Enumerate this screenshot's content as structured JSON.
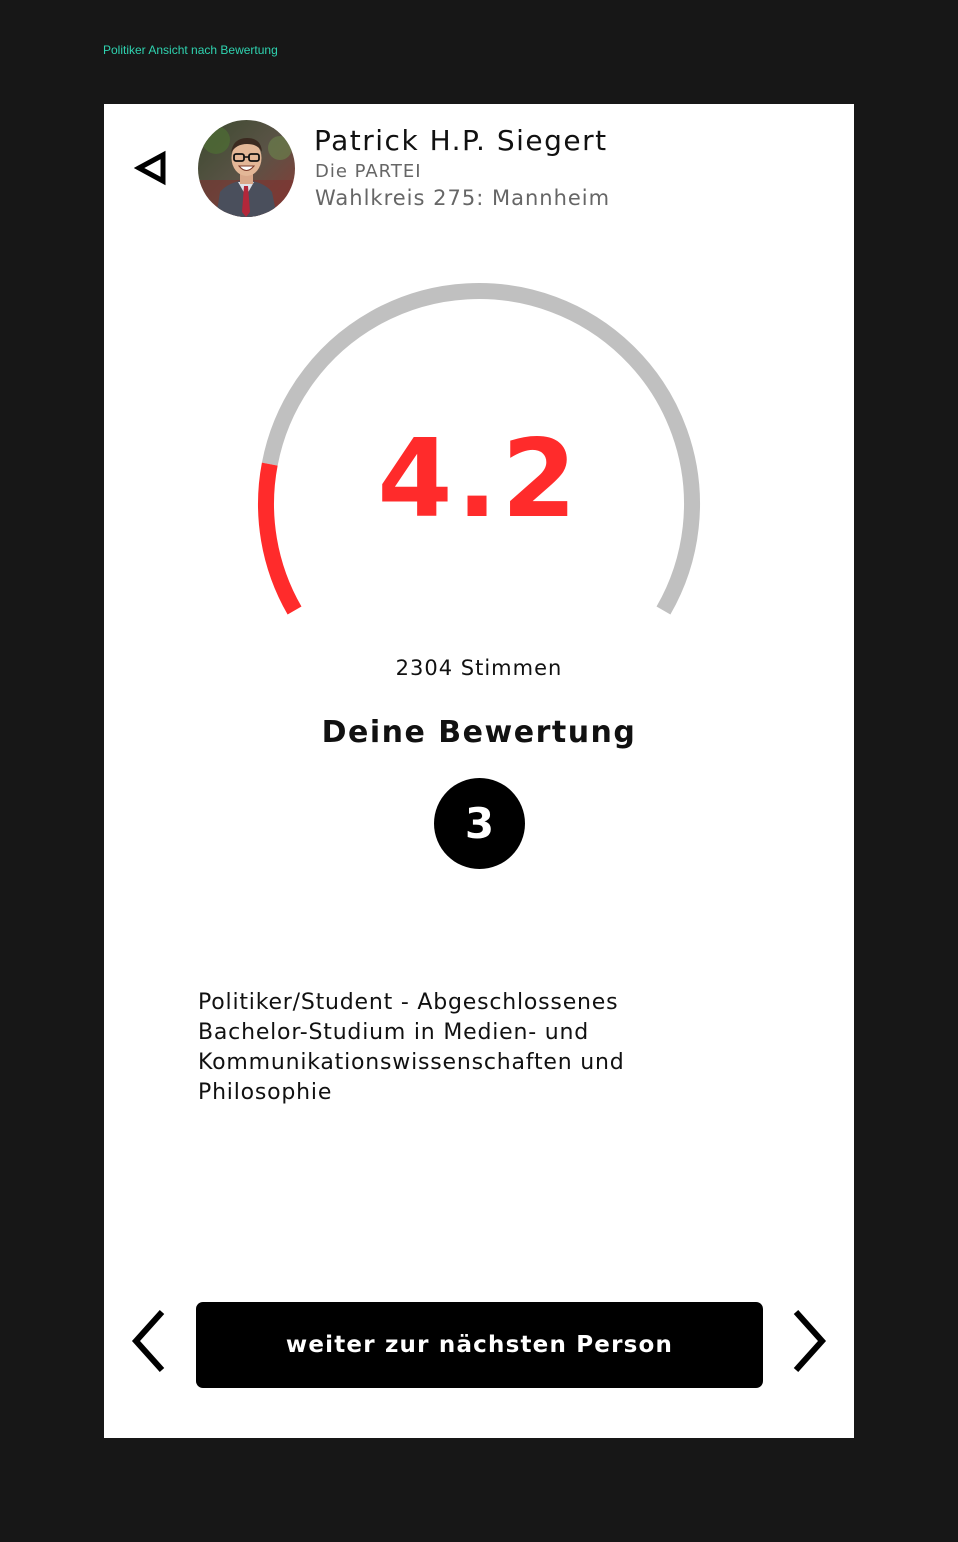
{
  "artboard": {
    "label": "Politiker Ansicht nach Bewertung",
    "label_color": "#2fd3b0"
  },
  "header": {
    "back_icon": "triangle-left-outline-icon",
    "avatar_alt": "Portrait",
    "name": "Patrick H.P. Siegert",
    "party": "Die PARTEI",
    "district": "Wahlkreis 275: Mannheim"
  },
  "score": {
    "value": "4.2",
    "fill_fraction": 0.17,
    "accent_color": "#ff2b2b",
    "track_color": "#c0c0c0",
    "votes": "2304 Stimmen"
  },
  "user_rating": {
    "title": "Deine Bewertung",
    "value": "3"
  },
  "bio": {
    "text": "Politiker/Student - Abgeschlossenes Bachelor-Studium in Medien- und Kommunikationswissenschaften und Philosophie"
  },
  "footer": {
    "prev_icon": "chevron-left-icon",
    "next_icon": "chevron-right-icon",
    "button_label": "weiter zur nächsten Person"
  }
}
